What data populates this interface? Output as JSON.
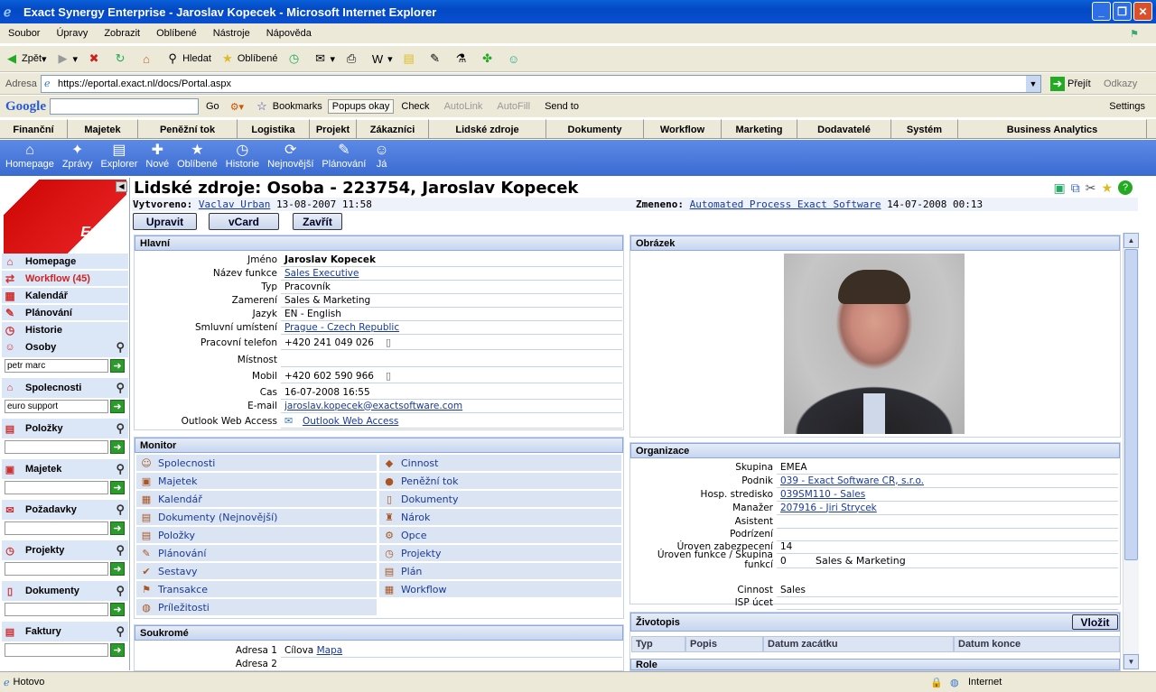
{
  "window": {
    "title": "Exact Synergy Enterprise - Jaroslav Kopecek - Microsoft Internet Explorer"
  },
  "menu": [
    "Soubor",
    "Úpravy",
    "Zobrazit",
    "Oblíbené",
    "Nástroje",
    "Nápověda"
  ],
  "toolbar": {
    "back": "Zpět",
    "search": "Hledat",
    "favorites": "Oblíbené"
  },
  "address": {
    "label": "Adresa",
    "url": "https://eportal.exact.nl/docs/Portal.aspx",
    "go": "Přejít",
    "links": "Odkazy"
  },
  "google": {
    "logo": "Google",
    "go": "Go",
    "bookmarks": "Bookmarks",
    "popups": "Popups okay",
    "check": "Check",
    "autolink": "AutoLink",
    "autofill": "AutoFill",
    "sendto": "Send to",
    "settings": "Settings"
  },
  "nav": [
    "Finanční",
    "Majetek",
    "Peněžní tok",
    "Logistika",
    "Projekt",
    "Zákazníci",
    "Lidské zdroje",
    "Dokumenty",
    "Workflow",
    "Marketing",
    "Dodavatelé",
    "Systém",
    "Business Analytics"
  ],
  "iconbar": [
    "Homepage",
    "Zprávy",
    "Explorer",
    "Nové",
    "Oblíbené",
    "Historie",
    "Nejnovější",
    "Plánování",
    "Já"
  ],
  "logo": {
    "brand": "Exact",
    "sub": "software"
  },
  "sidebar": {
    "links": [
      "Homepage",
      "Workflow (45)",
      "Kalendář",
      "Plánování",
      "Historie"
    ],
    "sections": [
      {
        "label": "Osoby",
        "value": "petr marc"
      },
      {
        "label": "Spolecnosti",
        "value": "euro support"
      },
      {
        "label": "Položky",
        "value": ""
      },
      {
        "label": "Majetek",
        "value": ""
      },
      {
        "label": "Požadavky",
        "value": ""
      },
      {
        "label": "Projekty",
        "value": ""
      },
      {
        "label": "Dokumenty",
        "value": ""
      },
      {
        "label": "Faktury",
        "value": ""
      }
    ]
  },
  "page": {
    "title": "Lidské zdroje: Osoba - 223754, Jaroslav Kopecek",
    "created_label": "Vytvoreno:",
    "created_by": "Vaclav Urban",
    "created_at": "13-08-2007 11:58",
    "changed_label": "Zmeneno:",
    "changed_by": "Automated Process Exact Software",
    "changed_at": "14-07-2008 00:13",
    "buttons": {
      "edit": "Upravit",
      "vcard": "vCard",
      "close": "Zavřít"
    }
  },
  "hlavni": {
    "title": "Hlavní",
    "rows": [
      {
        "label": "Jméno",
        "value": "Jaroslav Kopecek"
      },
      {
        "label": "Název funkce",
        "value": "Sales Executive"
      },
      {
        "label": "Typ",
        "value": "Pracovník"
      },
      {
        "label": "Zamerení",
        "value": "Sales & Marketing"
      },
      {
        "label": "Jazyk",
        "value": "EN - English"
      },
      {
        "label": "Smluvní umístení",
        "value": "Prague - Czech Republic"
      },
      {
        "label": "Pracovní telefon",
        "value": "+420 241 049 026"
      },
      {
        "label": "Místnost",
        "value": ""
      },
      {
        "label": "Mobil",
        "value": "+420 602 590 966"
      },
      {
        "label": "Cas",
        "value": "16-07-2008 16:55"
      },
      {
        "label": "E-mail",
        "value": "jaroslav.kopecek@exactsoftware.com"
      },
      {
        "label": "Outlook Web Access",
        "value": "Outlook Web Access"
      }
    ]
  },
  "monitor": {
    "title": "Monitor",
    "left": [
      "Spolecnosti",
      "Majetek",
      "Kalendář",
      "Dokumenty (Nejnovější)",
      "Položky",
      "Plánování",
      "Sestavy",
      "Transakce",
      "Príležitosti"
    ],
    "right": [
      "Cinnost",
      "Peněžní tok",
      "Dokumenty",
      "Nárok",
      "Opce",
      "Projekty",
      "Plán",
      "Workflow"
    ]
  },
  "soukrome": {
    "title": "Soukromé",
    "rows": [
      {
        "label": "Adresa 1",
        "value": "Cílova",
        "link": "Mapa"
      },
      {
        "label": "Adresa 2",
        "value": ""
      }
    ]
  },
  "obrazek": {
    "title": "Obrázek"
  },
  "organizace": {
    "title": "Organizace",
    "rows": [
      {
        "label": "Skupina",
        "value": "EMEA"
      },
      {
        "label": "Podnik",
        "value": "039 - Exact Software CR, s.r.o."
      },
      {
        "label": "Hosp. stredisko",
        "value": "039SM110 - Sales"
      },
      {
        "label": "Manažer",
        "value": "207916 - Jiri Strycek"
      },
      {
        "label": "Asistent",
        "value": ""
      },
      {
        "label": "Podrízení",
        "value": ""
      },
      {
        "label": "Úroven zabezpecení",
        "value": "14"
      },
      {
        "label": "Úroven funkce / Skupina funkcí",
        "value": "0",
        "extra": "Sales & Marketing"
      },
      {
        "label": "Cinnost",
        "value": "Sales"
      },
      {
        "label": "ISP úcet",
        "value": ""
      }
    ]
  },
  "zivotopis": {
    "title": "Životopis",
    "button": "Vložit",
    "columns": [
      "Typ",
      "Popis",
      "Datum zacátku",
      "Datum konce"
    ]
  },
  "role": {
    "title": "Role"
  },
  "status": {
    "text": "Hotovo",
    "zone": "Internet"
  }
}
